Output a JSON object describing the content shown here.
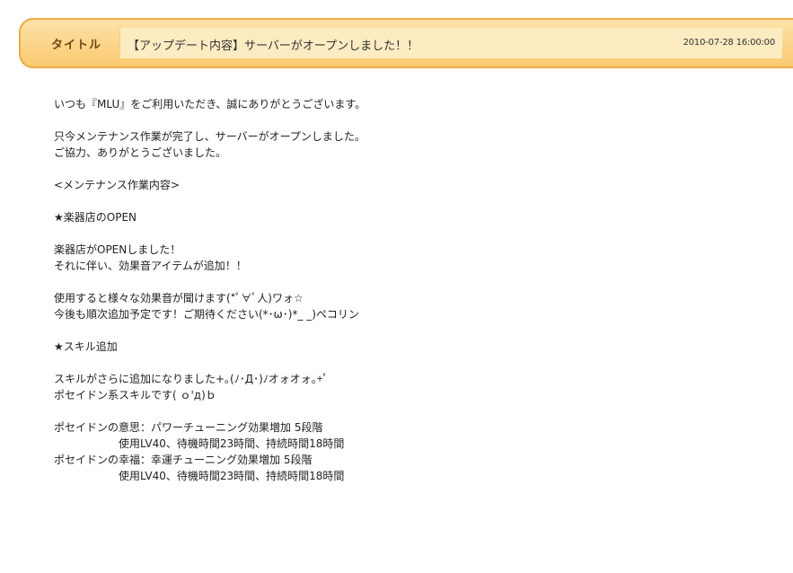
{
  "header": {
    "label": "タイトル",
    "title": "【アップデート内容】サーバーがオープンしました！！",
    "date": "2010-07-28 16:00:00"
  },
  "body": {
    "l1": "いつも『MLU』をご利用いただき、誠にありがとうございます。",
    "l2": "只今メンテナンス作業が完了し、サーバーがオープンしました。",
    "l3": "ご協力、ありがとうございました。",
    "l4": "<メンテナンス作業内容>",
    "l5": "★楽器店のOPEN",
    "l6": "楽器店がOPENしました！",
    "l7": "それに伴い、効果音アイテムが追加！！",
    "l8": "使用すると様々な効果音が聞けます(*ﾟ∀ﾟ人)ワォ☆",
    "l9": "今後も順次追加予定です！ご期待ください(*･ω･)*_ _)ペコリン",
    "l10": "★スキル追加",
    "l11": "スキルがさらに追加になりました+｡(ﾉ･Д･)ﾉオォオォ｡+ﾟ",
    "l12": "ポセイドン系スキルです( ｏ'д)ｂ",
    "l13": "ポセイドンの意思：パワーチューニング効果増加 5段階",
    "l14": "使用LV40、待機時間23時間、持続時間18時間",
    "l15": "ポセイドンの幸福：幸運チューニング効果増加 5段階",
    "l16": "使用LV40、待機時間23時間、持続時間18時間"
  }
}
